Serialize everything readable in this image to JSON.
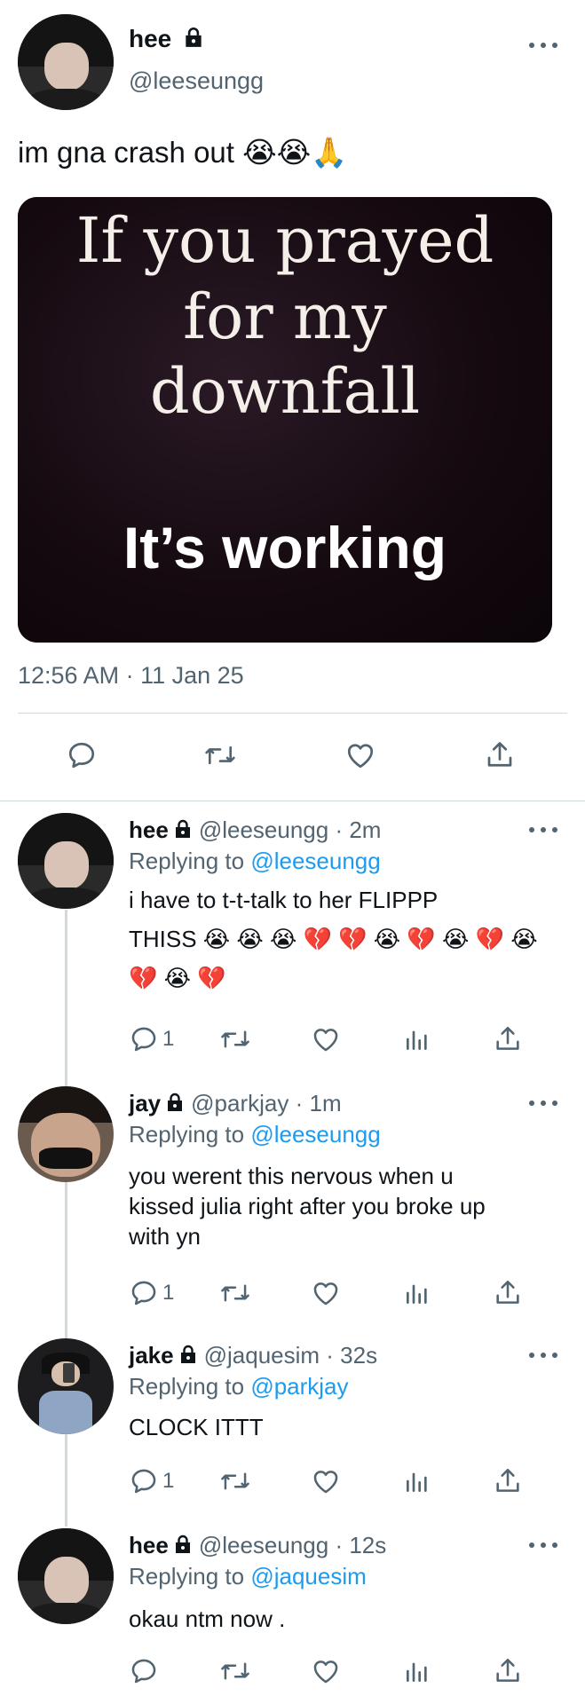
{
  "main_tweet": {
    "name": "hee",
    "handle": "@leeseungg",
    "text": "im gna crash out 😭😭🙏",
    "media": {
      "line1": "If you prayed",
      "line2": "for my",
      "line3": "downfall",
      "line4": "It’s working"
    },
    "timestamp": "12:56 AM · 11 Jan 25"
  },
  "replies": [
    {
      "name": "hee",
      "handle": "@leeseungg",
      "time": "· 2m",
      "replying_prefix": "Replying to",
      "replying_to": "@leeseungg",
      "text_lines": [
        "i have to t-t-talk to her FLIPPP",
        "THISS 😭 😭 😭 💔 💔 😭 💔 😭 💔 😭",
        "💔 😭 💔"
      ],
      "reply_count": "1"
    },
    {
      "name": "jay",
      "handle": "@parkjay",
      "time": "· 1m",
      "replying_prefix": "Replying to",
      "replying_to": "@leeseungg",
      "text_lines": [
        "you werent this nervous when u",
        "kissed julia right after you broke up",
        "with yn"
      ],
      "reply_count": "1"
    },
    {
      "name": "jake",
      "handle": "@jaquesim",
      "time": "· 32s",
      "replying_prefix": "Replying to",
      "replying_to": "@parkjay",
      "text_lines": [
        "CLOCK ITTT"
      ],
      "reply_count": "1"
    },
    {
      "name": "hee",
      "handle": "@leeseungg",
      "time": "· 12s",
      "replying_prefix": "Replying to",
      "replying_to": "@jaquesim",
      "text_lines": [
        "okau ntm now ."
      ],
      "reply_count": ""
    }
  ],
  "colors": {
    "text": "#0f1419",
    "secondary": "#536471",
    "link": "#1d9bf0",
    "divider": "#cfd9de"
  },
  "icons": [
    "lock-icon",
    "more-icon",
    "reply-icon",
    "retweet-icon",
    "like-icon",
    "share-icon",
    "analytics-icon"
  ]
}
